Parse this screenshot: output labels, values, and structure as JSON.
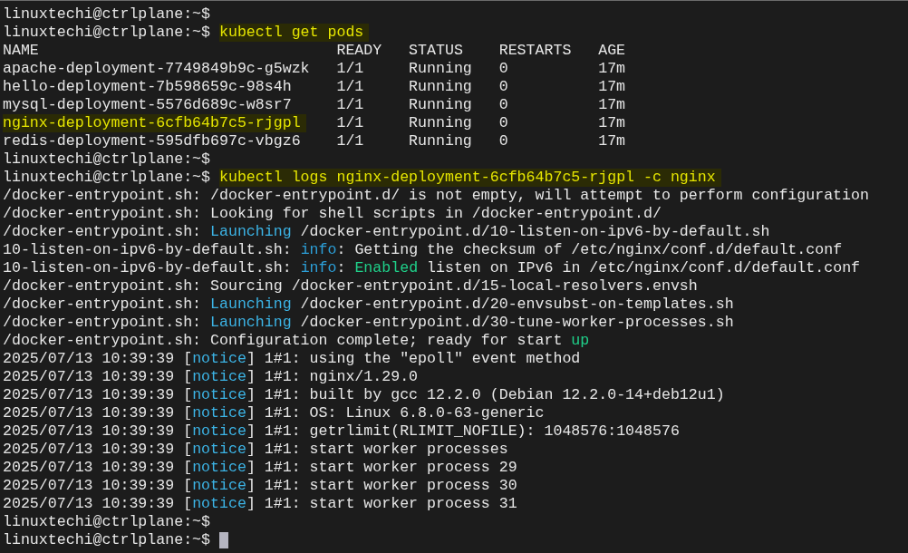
{
  "terminal": {
    "lines": [
      {
        "kind": "prompt",
        "prompt": "linuxtechi@ctrlplane:~$"
      },
      {
        "kind": "prompt",
        "prompt": "linuxtechi@ctrlplane:~$",
        "command": "kubectl get pods",
        "highlighted": true
      },
      {
        "kind": "table",
        "columns": [
          "NAME",
          "READY",
          "STATUS",
          "RESTARTS",
          "AGE"
        ],
        "rows": [
          {
            "cells": [
              "apache-deployment-7749849b9c-g5wzk",
              "1/1",
              "Running",
              "0",
              "17m"
            ],
            "highlighted": false
          },
          {
            "cells": [
              "hello-deployment-7b598659c-98s4h",
              "1/1",
              "Running",
              "0",
              "17m"
            ],
            "highlighted": false
          },
          {
            "cells": [
              "mysql-deployment-5576d689c-w8sr7",
              "1/1",
              "Running",
              "0",
              "17m"
            ],
            "highlighted": false
          },
          {
            "cells": [
              "nginx-deployment-6cfb64b7c5-rjgpl",
              "1/1",
              "Running",
              "0",
              "17m"
            ],
            "highlighted": true
          },
          {
            "cells": [
              "redis-deployment-595dfb697c-vbgz6",
              "1/1",
              "Running",
              "0",
              "17m"
            ],
            "highlighted": false
          }
        ]
      },
      {
        "kind": "prompt",
        "prompt": "linuxtechi@ctrlplane:~$"
      },
      {
        "kind": "prompt",
        "prompt": "linuxtechi@ctrlplane:~$",
        "command": "kubectl logs nginx-deployment-6cfb64b7c5-rjgpl -c nginx",
        "highlighted": true
      },
      {
        "kind": "log",
        "segments": [
          {
            "kind": "plain",
            "text": "/docker-entrypoint.sh: /docker-entrypoint.d/ is not empty, will attempt to perform configuration"
          }
        ]
      },
      {
        "kind": "log",
        "segments": [
          {
            "kind": "plain",
            "text": "/docker-entrypoint.sh: Looking for shell scripts in /docker-entrypoint.d/"
          }
        ]
      },
      {
        "kind": "log",
        "segments": [
          {
            "kind": "plain",
            "text": "/docker-entrypoint.sh: "
          },
          {
            "kind": "cyan",
            "text": "Launching"
          },
          {
            "kind": "plain",
            "text": " /docker-entrypoint.d/10-listen-on-ipv6-by-default.sh"
          }
        ]
      },
      {
        "kind": "log",
        "segments": [
          {
            "kind": "plain",
            "text": "10-listen-on-ipv6-by-default.sh: "
          },
          {
            "kind": "blue",
            "text": "info"
          },
          {
            "kind": "plain",
            "text": ": Getting the checksum of /etc/nginx/conf.d/default.conf"
          }
        ]
      },
      {
        "kind": "log",
        "segments": [
          {
            "kind": "plain",
            "text": "10-listen-on-ipv6-by-default.sh: "
          },
          {
            "kind": "blue",
            "text": "info"
          },
          {
            "kind": "plain",
            "text": ": "
          },
          {
            "kind": "green",
            "text": "Enabled"
          },
          {
            "kind": "plain",
            "text": " listen on IPv6 in /etc/nginx/conf.d/default.conf"
          }
        ]
      },
      {
        "kind": "log",
        "segments": [
          {
            "kind": "plain",
            "text": "/docker-entrypoint.sh: Sourcing /docker-entrypoint.d/15-local-resolvers.envsh"
          }
        ]
      },
      {
        "kind": "log",
        "segments": [
          {
            "kind": "plain",
            "text": "/docker-entrypoint.sh: "
          },
          {
            "kind": "cyan",
            "text": "Launching"
          },
          {
            "kind": "plain",
            "text": " /docker-entrypoint.d/20-envsubst-on-templates.sh"
          }
        ]
      },
      {
        "kind": "log",
        "segments": [
          {
            "kind": "plain",
            "text": "/docker-entrypoint.sh: "
          },
          {
            "kind": "cyan",
            "text": "Launching"
          },
          {
            "kind": "plain",
            "text": " /docker-entrypoint.d/30-tune-worker-processes.sh"
          }
        ]
      },
      {
        "kind": "log",
        "segments": [
          {
            "kind": "plain",
            "text": "/docker-entrypoint.sh: Configuration complete; ready for start "
          },
          {
            "kind": "green",
            "text": "up"
          }
        ]
      },
      {
        "kind": "log",
        "segments": [
          {
            "kind": "plain",
            "text": "2025/07/13 10:39:39 ["
          },
          {
            "kind": "cyan",
            "text": "notice"
          },
          {
            "kind": "plain",
            "text": "] 1#1: using the \"epoll\" event method"
          }
        ]
      },
      {
        "kind": "log",
        "segments": [
          {
            "kind": "plain",
            "text": "2025/07/13 10:39:39 ["
          },
          {
            "kind": "cyan",
            "text": "notice"
          },
          {
            "kind": "plain",
            "text": "] 1#1: nginx/1.29.0"
          }
        ]
      },
      {
        "kind": "log",
        "segments": [
          {
            "kind": "plain",
            "text": "2025/07/13 10:39:39 ["
          },
          {
            "kind": "cyan",
            "text": "notice"
          },
          {
            "kind": "plain",
            "text": "] 1#1: built by gcc 12.2.0 (Debian 12.2.0-14+deb12u1)"
          }
        ]
      },
      {
        "kind": "log",
        "segments": [
          {
            "kind": "plain",
            "text": "2025/07/13 10:39:39 ["
          },
          {
            "kind": "cyan",
            "text": "notice"
          },
          {
            "kind": "plain",
            "text": "] 1#1: OS: Linux 6.8.0-63-generic"
          }
        ]
      },
      {
        "kind": "log",
        "segments": [
          {
            "kind": "plain",
            "text": "2025/07/13 10:39:39 ["
          },
          {
            "kind": "cyan",
            "text": "notice"
          },
          {
            "kind": "plain",
            "text": "] 1#1: getrlimit(RLIMIT_NOFILE): 1048576:1048576"
          }
        ]
      },
      {
        "kind": "log",
        "segments": [
          {
            "kind": "plain",
            "text": "2025/07/13 10:39:39 ["
          },
          {
            "kind": "cyan",
            "text": "notice"
          },
          {
            "kind": "plain",
            "text": "] 1#1: start worker processes"
          }
        ]
      },
      {
        "kind": "log",
        "segments": [
          {
            "kind": "plain",
            "text": "2025/07/13 10:39:39 ["
          },
          {
            "kind": "cyan",
            "text": "notice"
          },
          {
            "kind": "plain",
            "text": "] 1#1: start worker process 29"
          }
        ]
      },
      {
        "kind": "log",
        "segments": [
          {
            "kind": "plain",
            "text": "2025/07/13 10:39:39 ["
          },
          {
            "kind": "cyan",
            "text": "notice"
          },
          {
            "kind": "plain",
            "text": "] 1#1: start worker process 30"
          }
        ]
      },
      {
        "kind": "log",
        "segments": [
          {
            "kind": "plain",
            "text": "2025/07/13 10:39:39 ["
          },
          {
            "kind": "cyan",
            "text": "notice"
          },
          {
            "kind": "plain",
            "text": "] 1#1: start worker process 31"
          }
        ]
      },
      {
        "kind": "prompt",
        "prompt": "linuxtechi@ctrlplane:~$"
      },
      {
        "kind": "prompt",
        "prompt": "linuxtechi@ctrlplane:~$",
        "cursor": true
      }
    ]
  }
}
